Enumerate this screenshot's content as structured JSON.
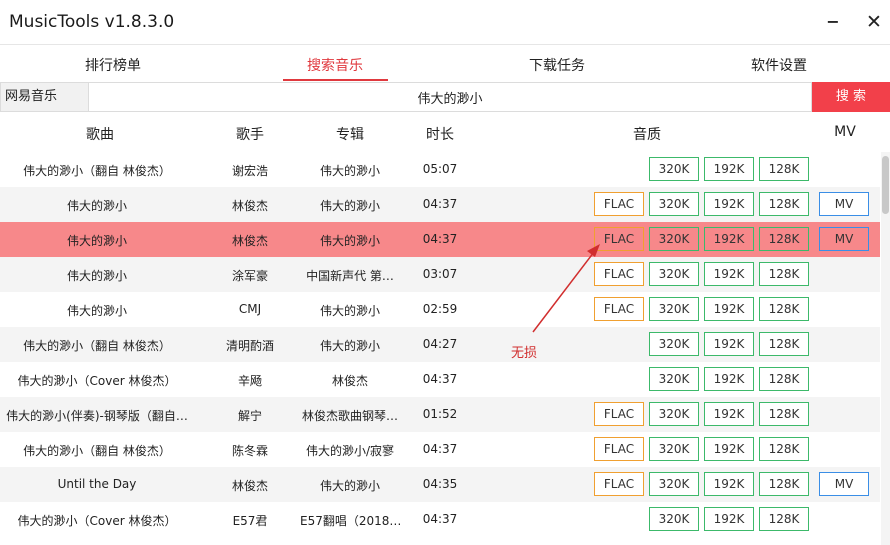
{
  "app": {
    "title": "MusicTools v1.8.3.0",
    "minimize": "−",
    "close": "✕"
  },
  "tabs": [
    {
      "label": "排行榜单"
    },
    {
      "label": "搜索音乐"
    },
    {
      "label": "下载任务"
    },
    {
      "label": "软件设置"
    }
  ],
  "active_tab": "搜索音乐",
  "search": {
    "source": "网易音乐",
    "query": "伟大的渺小",
    "button": "搜 索"
  },
  "columns": {
    "song": "歌曲",
    "singer": "歌手",
    "album": "专辑",
    "duration": "时长",
    "quality": "音质",
    "mv": "MV"
  },
  "buttons": {
    "flac": "FLAC",
    "q320": "320K",
    "q192": "192K",
    "q128": "128K",
    "mv": "MV"
  },
  "rows": [
    {
      "song": "伟大的渺小（翻自 林俊杰）",
      "singer": "谢宏浩",
      "album": "伟大的渺小",
      "duration": "05:07",
      "flac": false,
      "mv": false
    },
    {
      "song": "伟大的渺小",
      "singer": "林俊杰",
      "album": "伟大的渺小",
      "duration": "04:37",
      "flac": true,
      "mv": true
    },
    {
      "song": "伟大的渺小",
      "singer": "林俊杰",
      "album": "伟大的渺小",
      "duration": "04:37",
      "flac": true,
      "mv": true
    },
    {
      "song": "伟大的渺小",
      "singer": "涂军豪",
      "album": "中国新声代 第…",
      "duration": "03:07",
      "flac": true,
      "mv": false
    },
    {
      "song": "伟大的渺小",
      "singer": "CMJ",
      "album": "伟大的渺小",
      "duration": "02:59",
      "flac": true,
      "mv": false
    },
    {
      "song": "伟大的渺小（翻自 林俊杰）",
      "singer": "清明酌酒",
      "album": "伟大的渺小",
      "duration": "04:27",
      "flac": false,
      "mv": false
    },
    {
      "song": "伟大的渺小（Cover 林俊杰）",
      "singer": "辛飏",
      "album": "林俊杰",
      "duration": "04:37",
      "flac": false,
      "mv": false
    },
    {
      "song": "伟大的渺小(伴奏)-钢琴版（翻自…",
      "singer": "解宁",
      "album": "林俊杰歌曲钢琴…",
      "duration": "01:52",
      "flac": true,
      "mv": false
    },
    {
      "song": "伟大的渺小（翻自 林俊杰）",
      "singer": "陈冬霖",
      "album": "伟大的渺小/寂寥",
      "duration": "04:37",
      "flac": true,
      "mv": false
    },
    {
      "song": "Until the Day",
      "singer": "林俊杰",
      "album": "伟大的渺小",
      "duration": "04:35",
      "flac": true,
      "mv": true
    },
    {
      "song": "伟大的渺小（Cover 林俊杰）",
      "singer": "E57君",
      "album": "E57翻唱（2018…",
      "duration": "04:37",
      "flac": false,
      "mv": false
    }
  ],
  "selected_row_index": 2,
  "annotation": {
    "text": "无损"
  },
  "colors": {
    "accent": "#e0393e",
    "search_button": "#f2404a",
    "selected_row": "#f7888a",
    "flac_border": "#f0a030",
    "quality_border": "#3cb96a",
    "mv_border": "#3a8ee6",
    "annotation": "#d12e2e"
  }
}
